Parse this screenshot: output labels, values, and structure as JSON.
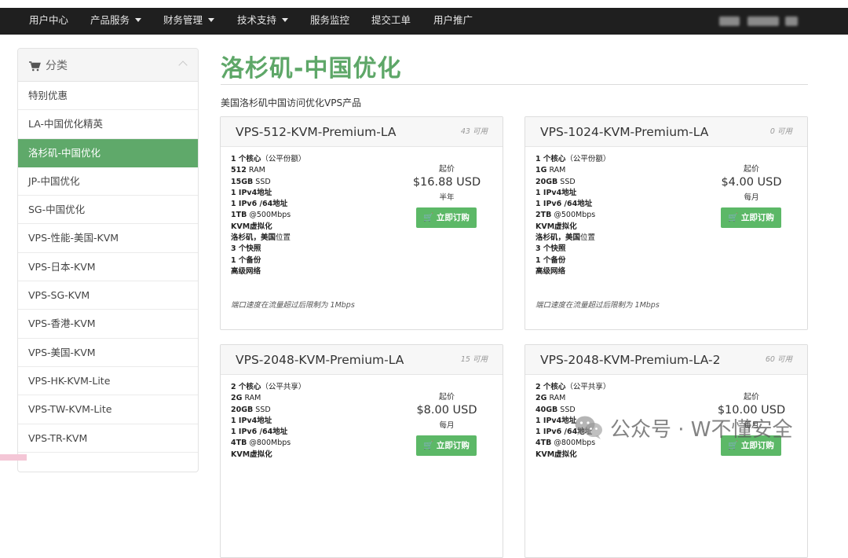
{
  "nav": {
    "items": [
      {
        "label": "用户中心",
        "dropdown": false
      },
      {
        "label": "产品服务",
        "dropdown": true
      },
      {
        "label": "财务管理",
        "dropdown": true
      },
      {
        "label": "技术支持",
        "dropdown": true
      },
      {
        "label": "服务监控",
        "dropdown": false
      },
      {
        "label": "提交工单",
        "dropdown": false
      },
      {
        "label": "用户推广",
        "dropdown": false
      }
    ]
  },
  "sidebar": {
    "title": "分类",
    "icon": "cart-icon",
    "items": [
      {
        "label": "特别优惠"
      },
      {
        "label": "LA-中国优化精英"
      },
      {
        "label": "洛杉矶-中国优化",
        "active": true
      },
      {
        "label": "JP-中国优化"
      },
      {
        "label": "SG-中国优化"
      },
      {
        "label": "VPS-性能-美国-KVM"
      },
      {
        "label": "VPS-日本-KVM"
      },
      {
        "label": "VPS-SG-KVM"
      },
      {
        "label": "VPS-香港-KVM"
      },
      {
        "label": "VPS-美国-KVM"
      },
      {
        "label": "VPS-HK-KVM-Lite"
      },
      {
        "label": "VPS-TW-KVM-Lite"
      },
      {
        "label": "VPS-TR-KVM"
      }
    ]
  },
  "main": {
    "title": "洛杉矶-中国优化",
    "subtitle": "美国洛杉矶中国访问优化VPS产品"
  },
  "products": [
    {
      "name": "VPS-512-KVM-Premium-LA",
      "qty": "43 可用",
      "features": [
        {
          "b": "1 个核心",
          "r": "（公平份额）"
        },
        {
          "b": "512",
          "r": " RAM"
        },
        {
          "b": "15GB",
          "r": " SSD"
        },
        {
          "b": "1 IPv4地址",
          "r": ""
        },
        {
          "b": "1 IPv6 /64地址",
          "r": ""
        },
        {
          "b": "1TB",
          "r": " @500Mbps"
        },
        {
          "b": "KVM虚拟化",
          "r": ""
        },
        {
          "b": "洛杉矶，美国",
          "r": "位置"
        },
        {
          "b": "3 个快照",
          "r": ""
        },
        {
          "b": "1 个备份",
          "r": ""
        },
        {
          "b": "高级网络",
          "r": ""
        }
      ],
      "from_label": "起价",
      "price": "$16.88 USD",
      "cycle": "半年",
      "button": "立即订购",
      "note": "端口速度在流量超过后限制为 1Mbps"
    },
    {
      "name": "VPS-1024-KVM-Premium-LA",
      "qty": "0 可用",
      "features": [
        {
          "b": "1 个核心",
          "r": "（公平份额）"
        },
        {
          "b": "1G",
          "r": " RAM"
        },
        {
          "b": "20GB",
          "r": " SSD"
        },
        {
          "b": "1 IPv4地址",
          "r": ""
        },
        {
          "b": "1 IPv6 /64地址",
          "r": ""
        },
        {
          "b": "2TB",
          "r": " @500Mbps"
        },
        {
          "b": "KVM虚拟化",
          "r": ""
        },
        {
          "b": "洛杉矶，美国",
          "r": "位置"
        },
        {
          "b": "3 个快照",
          "r": ""
        },
        {
          "b": "1 个备份",
          "r": ""
        },
        {
          "b": "高级网络",
          "r": ""
        }
      ],
      "from_label": "起价",
      "price": "$4.00 USD",
      "cycle": "每月",
      "button": "立即订购",
      "note": "端口速度在流量超过后限制为 1Mbps"
    },
    {
      "name": "VPS-2048-KVM-Premium-LA",
      "qty": "15 可用",
      "features": [
        {
          "b": "2 个核心",
          "r": "（公平共享）"
        },
        {
          "b": "2G",
          "r": " RAM"
        },
        {
          "b": "20GB",
          "r": " SSD"
        },
        {
          "b": "1 IPv4地址",
          "r": ""
        },
        {
          "b": "1 IPv6 /64地址",
          "r": ""
        },
        {
          "b": "4TB",
          "r": " @800Mbps"
        },
        {
          "b": "KVM虚拟化",
          "r": ""
        }
      ],
      "from_label": "起价",
      "price": "$8.00 USD",
      "cycle": "每月",
      "button": "立即订购",
      "note": ""
    },
    {
      "name": "VPS-2048-KVM-Premium-LA-2",
      "qty": "60 可用",
      "features": [
        {
          "b": "2 个核心",
          "r": "（公平共享）"
        },
        {
          "b": "2G",
          "r": " RAM"
        },
        {
          "b": "40GB",
          "r": " SSD"
        },
        {
          "b": "1 IPv4地址",
          "r": ""
        },
        {
          "b": "1 IPv6 /64地址",
          "r": ""
        },
        {
          "b": "4TB",
          "r": " @800Mbps"
        },
        {
          "b": "KVM虚拟化",
          "r": ""
        }
      ],
      "from_label": "起价",
      "price": "$10.00 USD",
      "cycle": "每月",
      "button": "立即订购",
      "note": ""
    }
  ],
  "watermark": {
    "text": "公众号 · W不懂安全",
    "icon": "wechat-icon"
  },
  "colors": {
    "topbar": "#1f1f1f",
    "accent": "#5ea768",
    "button": "#5cb867",
    "active_item": "#5fa96a"
  }
}
